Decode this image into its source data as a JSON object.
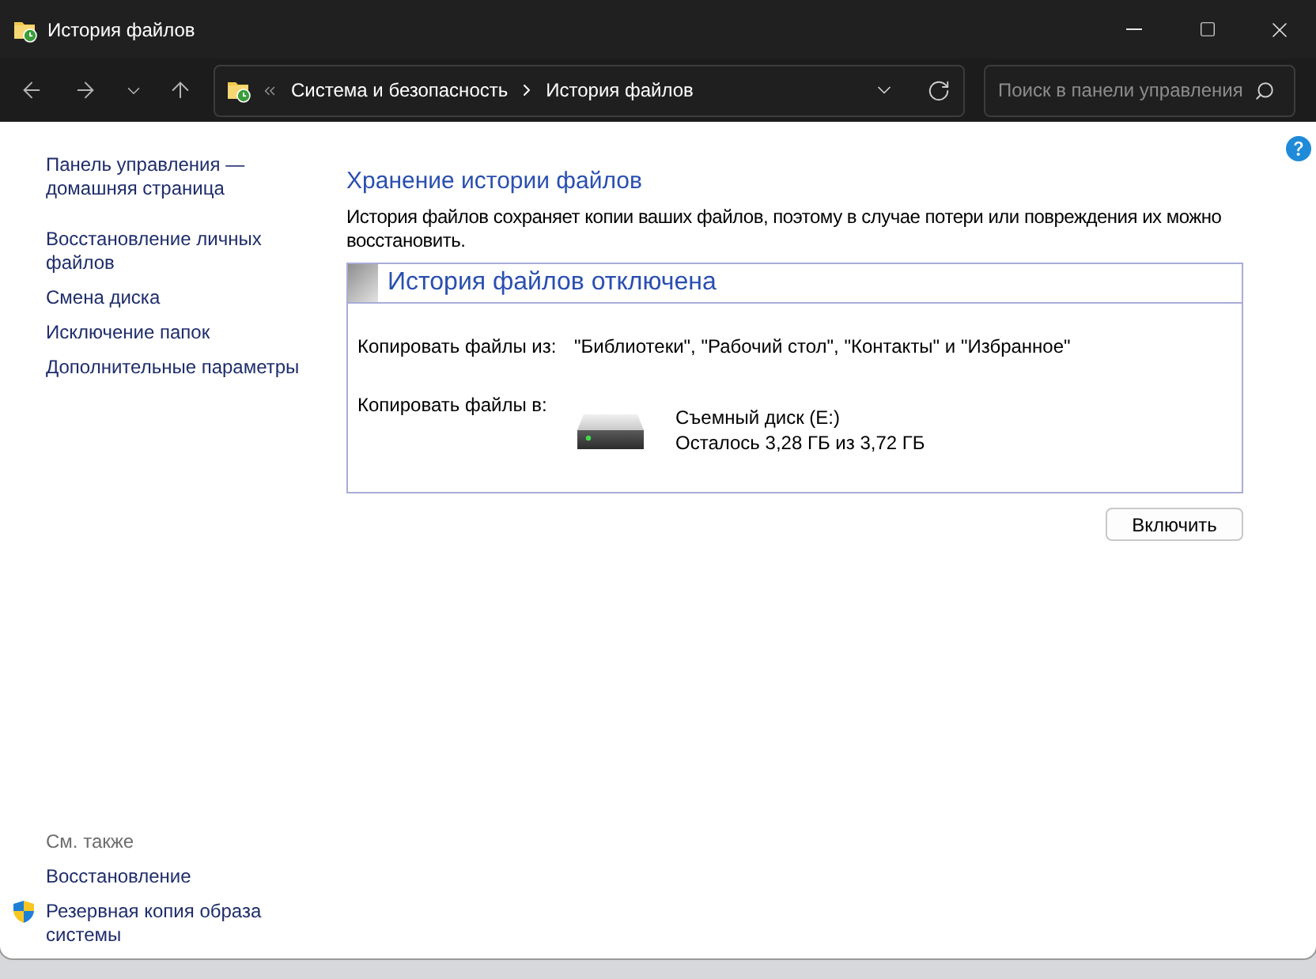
{
  "window": {
    "title": "История файлов"
  },
  "address_bar": {
    "breadcrumb": [
      "Система и безопасность",
      "История файлов"
    ]
  },
  "search": {
    "placeholder": "Поиск в панели управления"
  },
  "sidebar": {
    "home": "Панель управления — домашняя страница",
    "items": [
      "Восстановление личных файлов",
      "Смена диска",
      "Исключение папок",
      "Дополнительные параметры"
    ],
    "see_also": {
      "title": "См. также",
      "items": [
        {
          "label": "Восстановление",
          "kind": "link"
        },
        {
          "label": "Резервная копия образа системы",
          "kind": "shield_link"
        }
      ]
    }
  },
  "main": {
    "heading": "Хранение истории файлов",
    "description": "История файлов сохраняет копии ваших файлов, поэтому в случае потери или повреждения их можно восстановить.",
    "status_panel": {
      "title": "История файлов отключена",
      "on": false,
      "rows": [
        {
          "kind": "text",
          "label": "Копировать файлы из:",
          "value": "\"Библиотеки\", \"Рабочий стол\", \"Контакты\" и \"Избранное\""
        },
        {
          "kind": "drive",
          "label": "Копировать файлы в:",
          "drive_name": "Съемный диск (E:)",
          "space": "Осталось 3,28 ГБ из 3,72 ГБ"
        }
      ]
    },
    "buttons": [
      "Включить"
    ]
  }
}
